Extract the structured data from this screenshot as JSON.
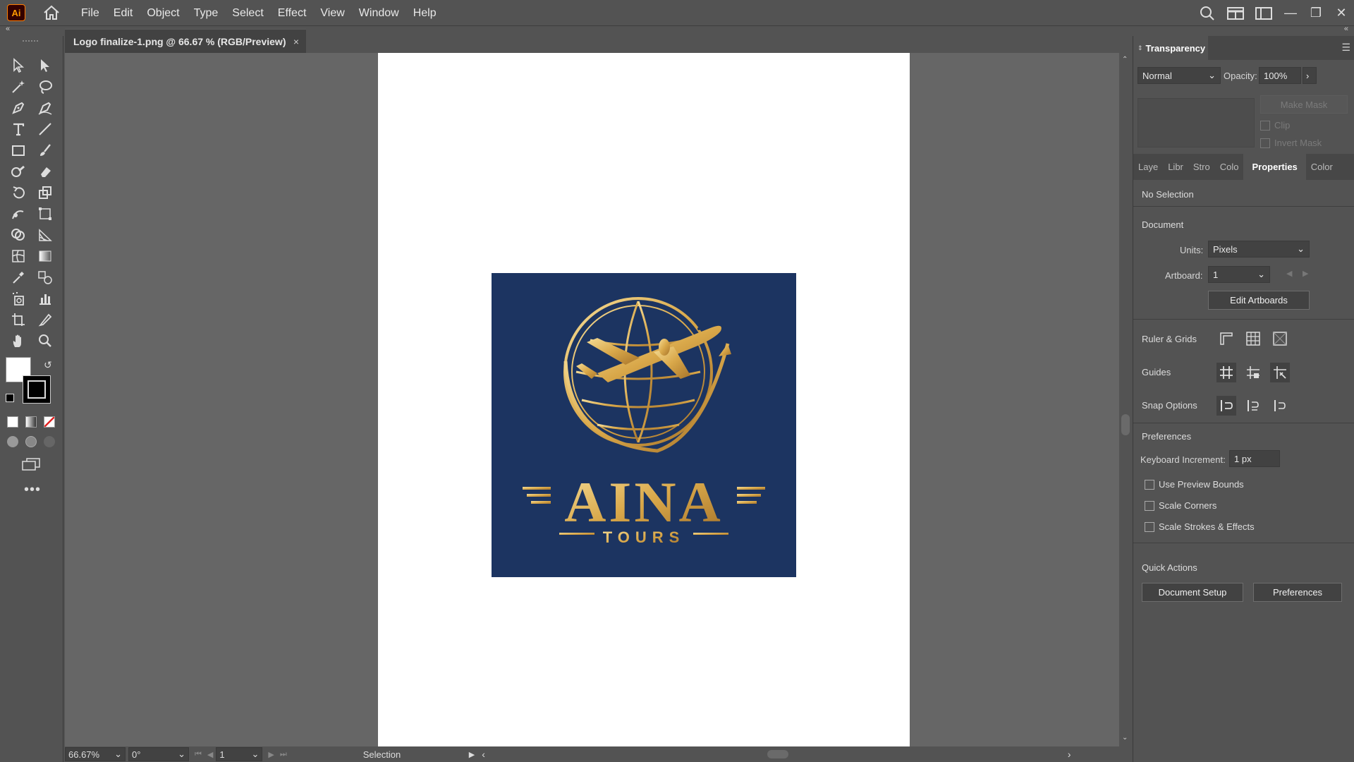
{
  "app": {
    "logo_text": "Ai"
  },
  "menu": [
    "File",
    "Edit",
    "Object",
    "Type",
    "Select",
    "Effect",
    "View",
    "Window",
    "Help"
  ],
  "document": {
    "tab_title": "Logo finalize-1.png @ 66.67 % (RGB/Preview)",
    "close_label": "×"
  },
  "artwork": {
    "brand": "AINA",
    "sub": "TOURS"
  },
  "status": {
    "zoom": "66.67%",
    "rotation": "0°",
    "artboard": "1",
    "tool": "Selection"
  },
  "transparency": {
    "title": "Transparency",
    "blend_mode": "Normal",
    "opacity_label": "Opacity:",
    "opacity_value": "100%",
    "make_mask": "Make Mask",
    "clip": "Clip",
    "invert_mask": "Invert Mask"
  },
  "panel_tabs": [
    "Laye",
    "Libr",
    "Stro",
    "Colo",
    "Properties",
    "Color"
  ],
  "properties": {
    "selection": "No Selection",
    "document_title": "Document",
    "units_label": "Units:",
    "units_value": "Pixels",
    "artboard_label": "Artboard:",
    "artboard_value": "1",
    "edit_artboards": "Edit Artboards",
    "ruler_grids": "Ruler & Grids",
    "guides": "Guides",
    "snap_options": "Snap Options",
    "preferences_title": "Preferences",
    "keyboard_increment_label": "Keyboard Increment:",
    "keyboard_increment_value": "1 px",
    "use_preview_bounds": "Use Preview Bounds",
    "scale_corners": "Scale Corners",
    "scale_strokes": "Scale Strokes & Effects",
    "quick_actions": "Quick Actions",
    "document_setup": "Document Setup",
    "preferences_button": "Preferences"
  },
  "colors": {
    "logo_bg": "#1c3461",
    "gold": "#d9a84a"
  }
}
